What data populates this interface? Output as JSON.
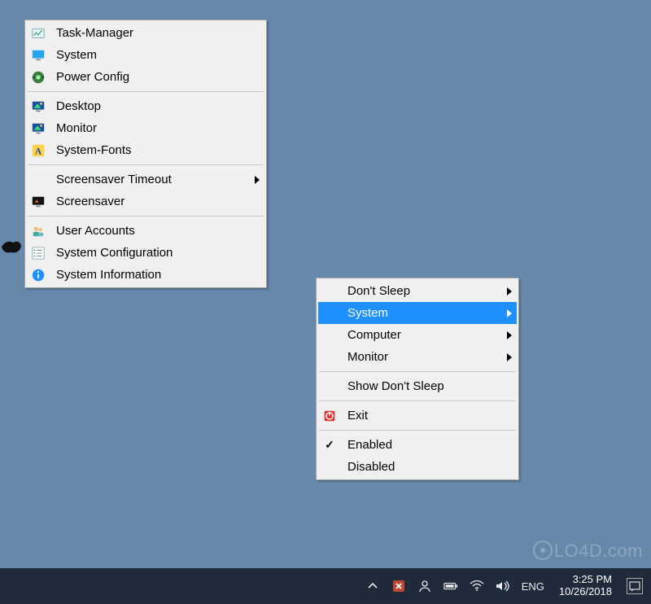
{
  "submenu": {
    "items": [
      {
        "label": "Task-Manager",
        "icon": "taskmgr"
      },
      {
        "label": "System",
        "icon": "monitor-blue"
      },
      {
        "label": "Power Config",
        "icon": "power-plug"
      },
      {
        "sep": true
      },
      {
        "label": "Desktop",
        "icon": "desktop-color"
      },
      {
        "label": "Monitor",
        "icon": "desktop-color"
      },
      {
        "label": "System-Fonts",
        "icon": "font-a"
      },
      {
        "sep": true
      },
      {
        "label": "Screensaver Timeout",
        "icon": "blank",
        "submenu": true
      },
      {
        "label": "Screensaver",
        "icon": "screensaver"
      },
      {
        "sep": true
      },
      {
        "label": "User Accounts",
        "icon": "users"
      },
      {
        "label": "System Configuration",
        "icon": "checklist"
      },
      {
        "label": "System Information",
        "icon": "info-blue"
      }
    ]
  },
  "mainmenu": {
    "items": [
      {
        "label": "Don't Sleep",
        "icon": "blank",
        "submenu": true
      },
      {
        "label": "System",
        "icon": "blank",
        "submenu": true,
        "selected": true
      },
      {
        "label": "Computer",
        "icon": "blank",
        "submenu": true
      },
      {
        "label": "Monitor",
        "icon": "blank",
        "submenu": true
      },
      {
        "sep": true
      },
      {
        "label": "Show Don't Sleep",
        "icon": "blank"
      },
      {
        "sep": true
      },
      {
        "label": "Exit",
        "icon": "exit-red"
      },
      {
        "sep": true
      },
      {
        "label": "Enabled",
        "icon": "check"
      },
      {
        "label": "Disabled",
        "icon": "blank"
      }
    ]
  },
  "taskbar": {
    "lang": "ENG",
    "time": "3:25 PM",
    "date": "10/26/2018"
  },
  "watermark": "LO4D.com"
}
